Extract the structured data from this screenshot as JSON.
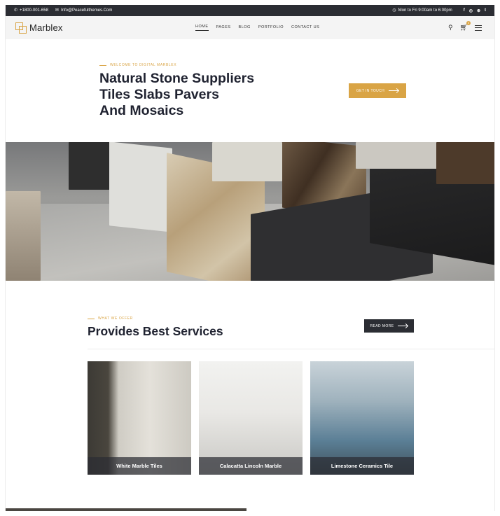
{
  "topbar": {
    "phone": "+1800-001-658",
    "email": "Info@Peacefulthemes.Com",
    "hours": "Mon to Fri 9:00am to 6:00pm",
    "social": [
      "f",
      "◎",
      "⊛",
      "t"
    ]
  },
  "header": {
    "logo": "Marblex",
    "nav": [
      "HOME",
      "PAGES",
      "BLOG",
      "PORTFOLIO",
      "CONTACT US"
    ],
    "cart_count": "0"
  },
  "hero": {
    "eyebrow": "WELCOME TO DIGITAL MARBLEX",
    "title_lines": [
      "Natural Stone Suppliers",
      "Tiles Slabs Pavers",
      "And Mosaics"
    ],
    "cta": "GET IN TOUCH"
  },
  "services": {
    "eyebrow": "WHAT WE OFFER",
    "title": "Provides Best Services",
    "cta": "READ MORE",
    "cards": [
      {
        "caption": "White Marble Tiles"
      },
      {
        "caption": "Calacatta Lincoln Marble"
      },
      {
        "caption": "Limestone Ceramics Tile"
      }
    ]
  },
  "colors": {
    "accent": "#d9a445",
    "dark": "#2b2d33",
    "header_bg": "#f4f4f4"
  }
}
